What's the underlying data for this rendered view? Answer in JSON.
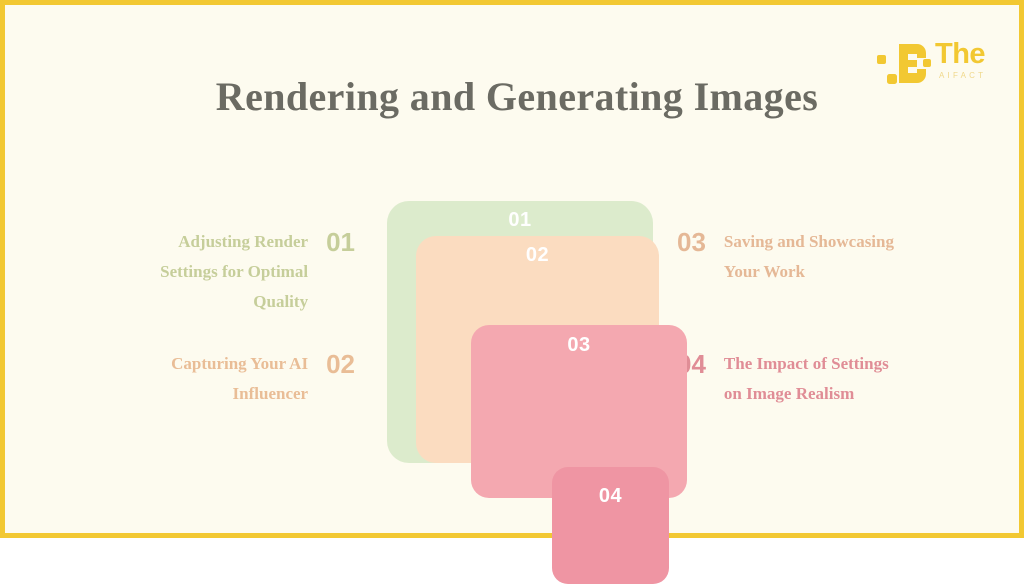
{
  "slide": {
    "title": "Rendering and Generating Images",
    "background_color": "#fdfbef",
    "border_color": "#f2c832"
  },
  "logo": {
    "wordmark": "The",
    "subtitle": "AIFACT",
    "color": "#f2c832",
    "subtitle_color": "#f0d88a"
  },
  "items": [
    {
      "number": "01",
      "label": "Adjusting Render Settings for Optimal Quality",
      "color": "#c6ce9a",
      "side": "left"
    },
    {
      "number": "02",
      "label": "Capturing Your AI Influencer",
      "color": "#e9bd96",
      "side": "left"
    },
    {
      "number": "03",
      "label": "Saving and Showcasing Your Work",
      "color": "#e5b896",
      "side": "right"
    },
    {
      "number": "04",
      "label": "The Impact of Settings on Image Realism",
      "color": "#e08d96",
      "side": "right"
    }
  ],
  "diagram": {
    "type": "nested-squares",
    "layers": [
      {
        "label": "01",
        "color": "#dcebcc"
      },
      {
        "label": "02",
        "color": "#fbdcc0"
      },
      {
        "label": "03",
        "color": "#f4a8b0"
      },
      {
        "label": "04",
        "color": "#ef95a3"
      }
    ]
  }
}
